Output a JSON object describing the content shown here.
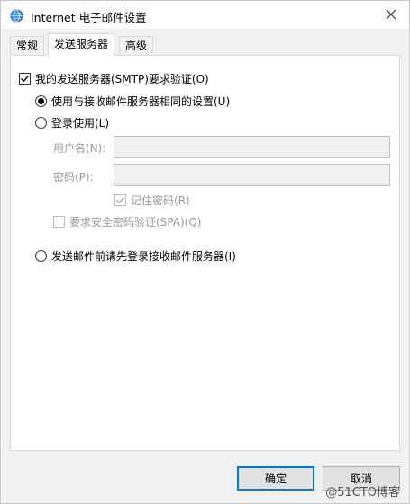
{
  "window": {
    "title": "Internet 电子邮件设置",
    "app_icon": "globe-mail-icon",
    "close_icon": "close-icon"
  },
  "tabs": [
    {
      "label": "常规",
      "active": false
    },
    {
      "label": "发送服务器",
      "active": true
    },
    {
      "label": "高级",
      "active": false
    }
  ],
  "outgoing": {
    "smtp_auth_label": "我的发送服务器(SMTP)要求验证(O)",
    "smtp_auth_checked": true,
    "use_same_label": "使用与接收邮件服务器相同的设置(U)",
    "use_same_selected": true,
    "login_using_label": "登录使用(L)",
    "login_using_selected": false,
    "username_label": "用户名(N):",
    "username_value": "",
    "password_label": "密码(P):",
    "password_value": "",
    "remember_password_label": "记住密码(R)",
    "remember_password_checked": true,
    "spa_label": "要求安全密码验证(SPA)(Q)",
    "spa_checked": false,
    "logon_before_label": "发送邮件前请先登录接收邮件服务器(I)",
    "logon_before_selected": false
  },
  "buttons": {
    "ok": "确定",
    "cancel": "取消"
  },
  "watermark": "@51CTO博客",
  "colors": {
    "accent": "#0078d7",
    "dialog_bg": "#f0f0f0",
    "disabled_text": "#9a9a9a"
  }
}
